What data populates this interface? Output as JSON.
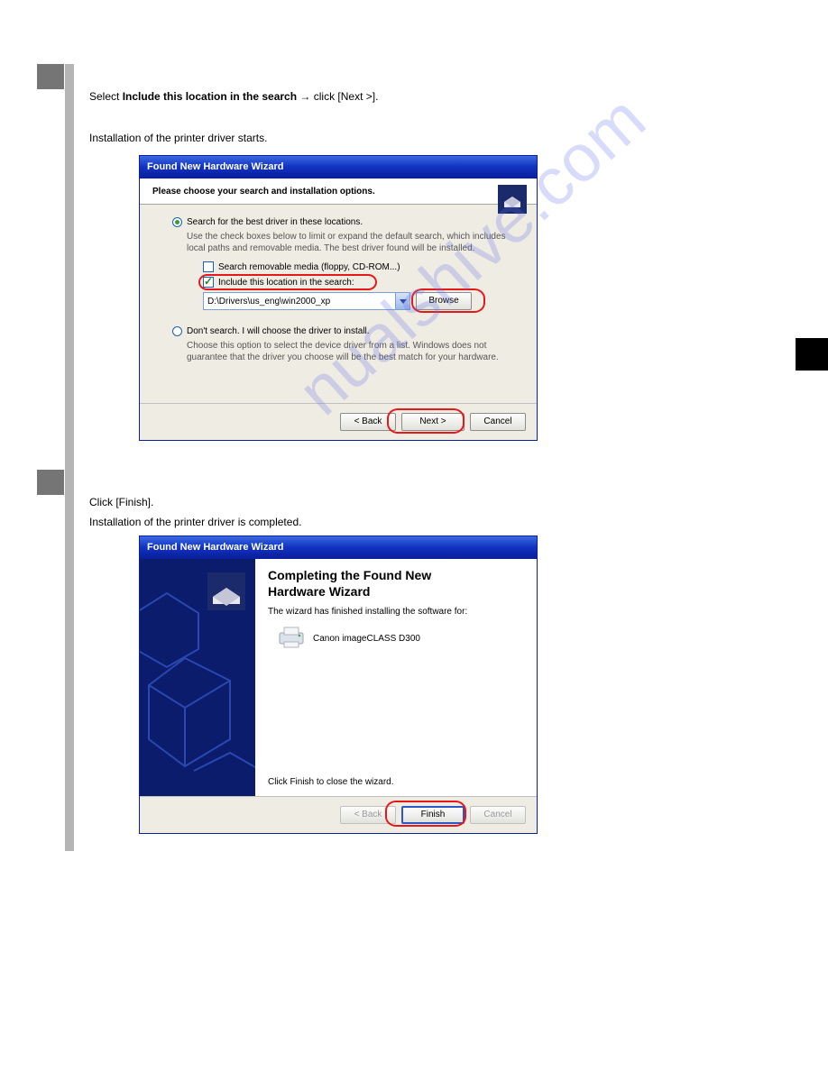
{
  "watermark": "nualshive.com",
  "steps": {
    "a_prefix": "Select ",
    "a_bold": "Include this location in the search",
    "a_suffix": " → click [Next >].",
    "b": "Installation of the printer driver starts.",
    "c": "Click [Finish].",
    "d": "Installation of the printer driver is completed."
  },
  "wizard1": {
    "title": "Found New Hardware Wizard",
    "header": "Please choose your search and installation options.",
    "radio1": "Search for the best driver in these locations.",
    "radio1_desc": "Use the check boxes below to limit or expand the default search, which includes local paths and removable media. The best driver found will be installed.",
    "chk_removable": "Search removable media (floppy, CD-ROM...)",
    "chk_include": "Include this location in the search:",
    "path": "D:\\Drivers\\us_eng\\win2000_xp",
    "browse": "Browse",
    "radio2": "Don't search. I will choose the driver to install.",
    "radio2_desc": "Choose this option to select the device driver from a list. Windows does not guarantee that the driver you choose will be the best match for your hardware.",
    "back": "< Back",
    "next": "Next >",
    "cancel": "Cancel"
  },
  "wizard2": {
    "title": "Found New Hardware Wizard",
    "heading_line1": "Completing the Found New",
    "heading_line2": "Hardware Wizard",
    "subtext": "The wizard has finished installing the software for:",
    "device": "Canon imageCLASS D300",
    "closetext": "Click Finish to close the wizard.",
    "back": "< Back",
    "finish": "Finish",
    "cancel": "Cancel"
  }
}
